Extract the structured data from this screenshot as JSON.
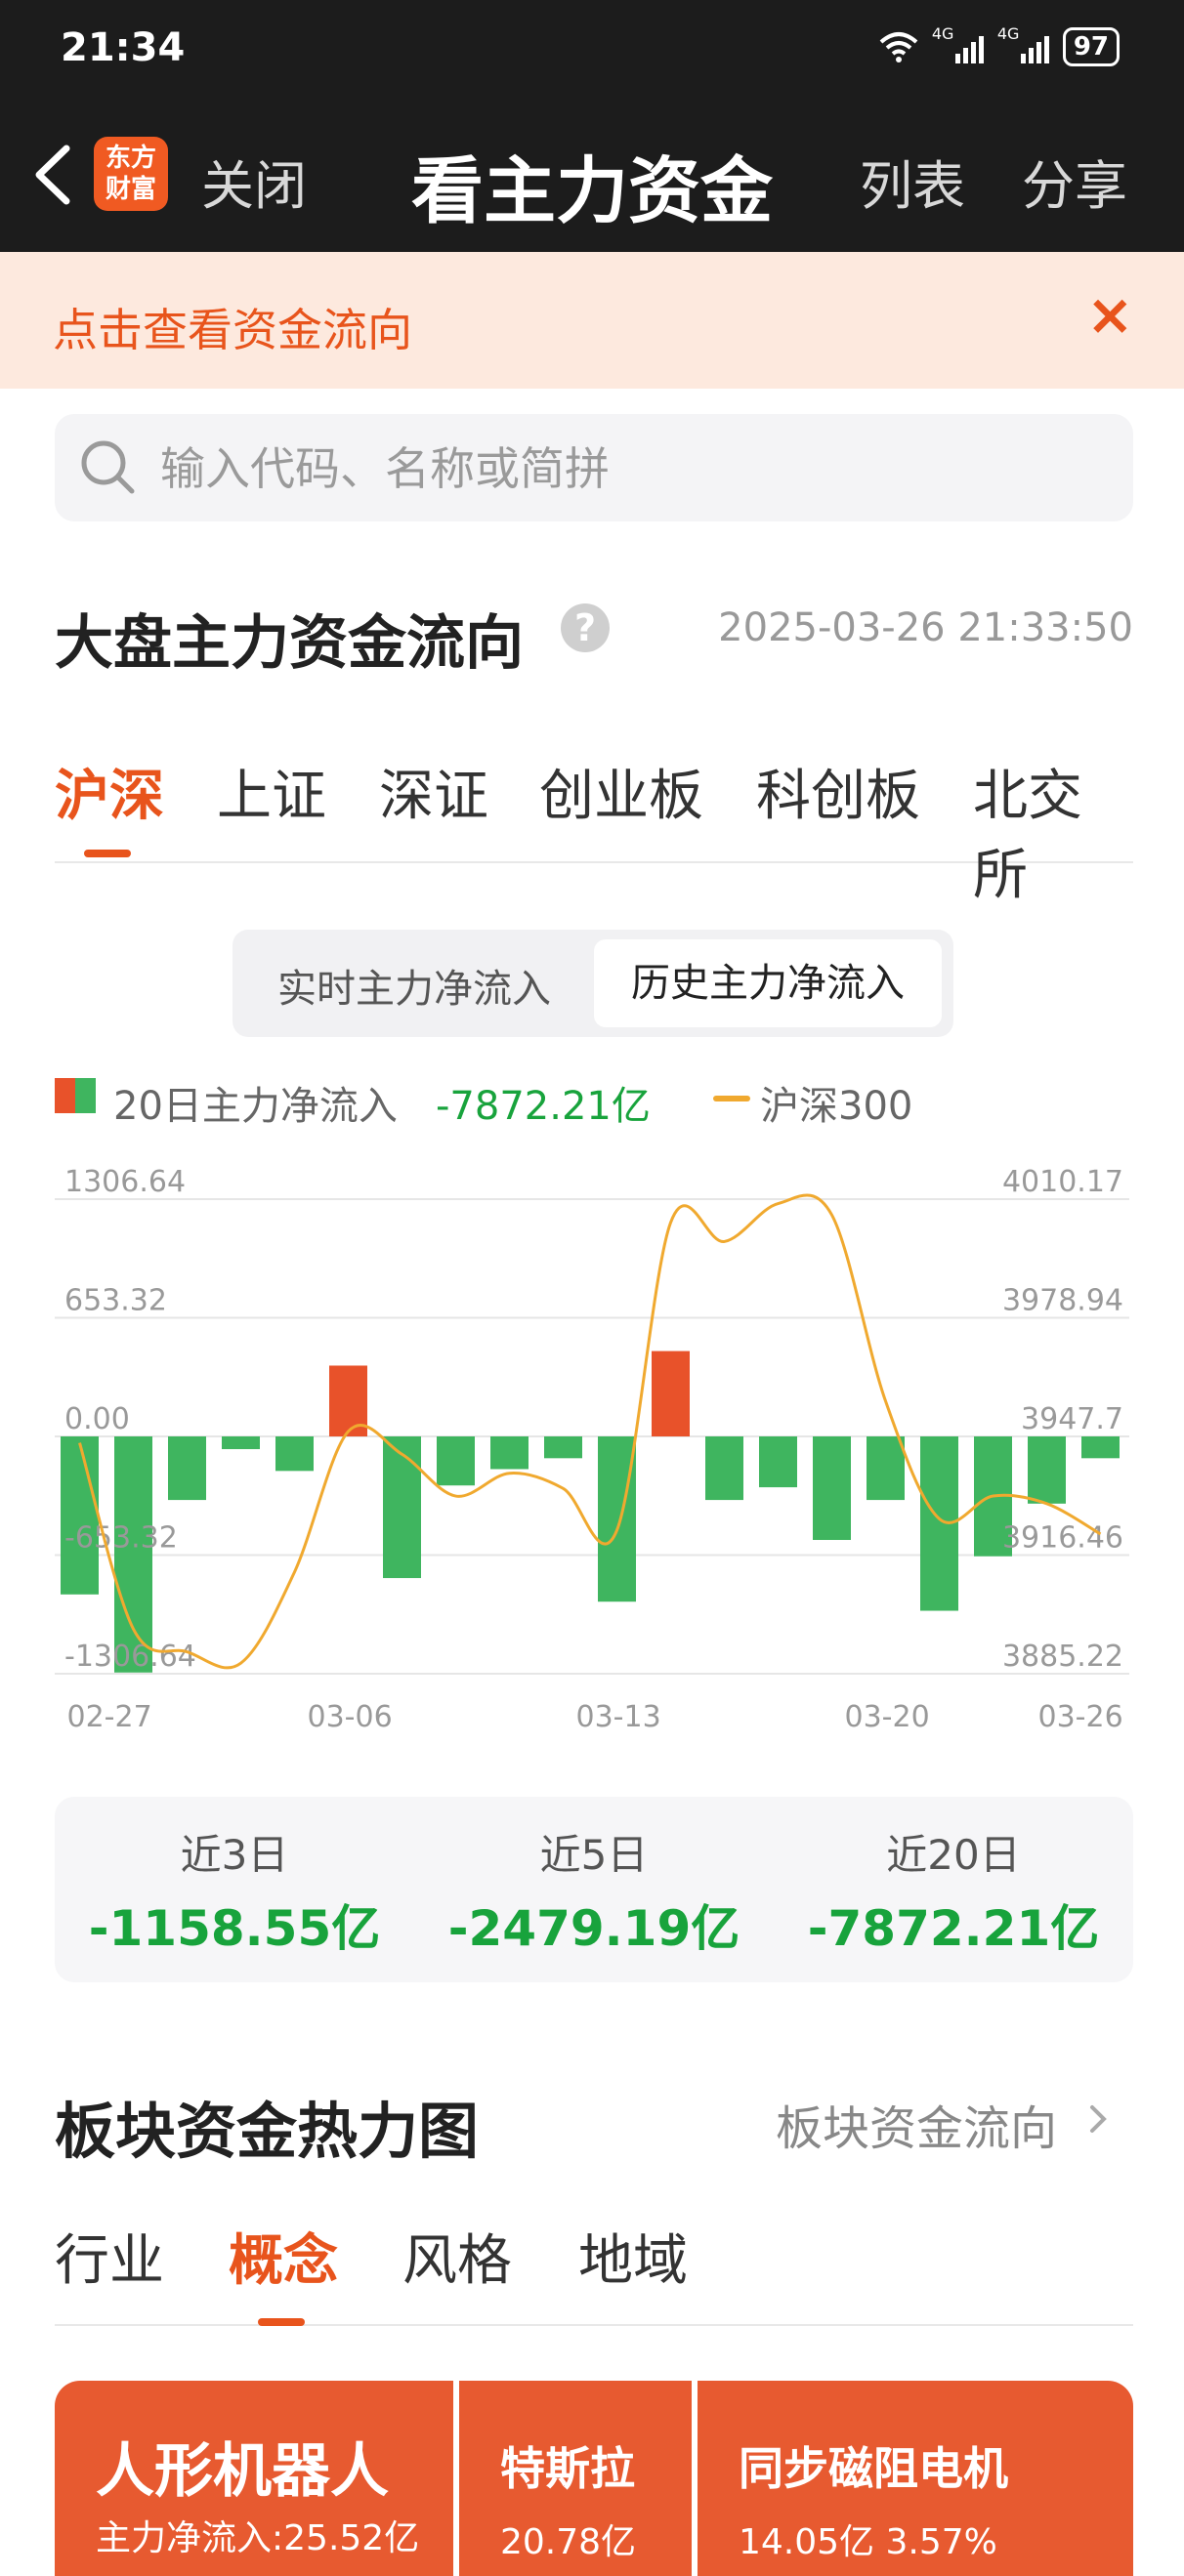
{
  "status": {
    "time": "21:34",
    "battery": "97",
    "net1": "4G",
    "net2": "4G"
  },
  "nav": {
    "close": "关闭",
    "title": "看主力资金",
    "list": "列表",
    "share": "分享",
    "logo_top": "东方",
    "logo_bottom": "财富"
  },
  "banner": {
    "text": "点击查看资金流向",
    "close_icon": "×"
  },
  "search": {
    "placeholder": "输入代码、名称或简拼"
  },
  "section1": {
    "title": "大盘主力资金流向",
    "help": "?",
    "timestamp": "2025-03-26 21:33:50"
  },
  "market_tabs": [
    "沪深",
    "上证",
    "深证",
    "创业板",
    "科创板",
    "北交所"
  ],
  "toggle": {
    "realtime": "实时主力净流入",
    "history": "历史主力净流入"
  },
  "legend": {
    "net_label": "20日主力净流入",
    "net_value": "-7872.21亿",
    "index_label": "沪深300"
  },
  "colors": {
    "accent": "#e8541c",
    "inflow": "#e8522a",
    "outflow": "#3fb55f",
    "index_line": "#f0a92f",
    "green_text": "#18a33c"
  },
  "chart_data": {
    "type": "bar",
    "left_ticks": [
      "1306.64",
      "653.32",
      "0.00",
      "-653.32",
      "-1306.64"
    ],
    "right_ticks": [
      "4010.17",
      "3978.94",
      "3947.7",
      "3916.46",
      "3885.22"
    ],
    "ylim": [
      -1306.64,
      1306.64
    ],
    "y2lim": [
      3885.22,
      4010.17
    ],
    "x_ticks": [
      "02-27",
      "03-06",
      "03-13",
      "03-20",
      "03-26"
    ],
    "categories": [
      "02-27",
      "02-28",
      "03-03",
      "03-04",
      "03-05",
      "03-06",
      "03-07",
      "03-10",
      "03-11",
      "03-12",
      "03-13",
      "03-14",
      "03-17",
      "03-18",
      "03-19",
      "03-20",
      "03-21",
      "03-24",
      "03-25",
      "03-26"
    ],
    "series": [
      {
        "values": [
          -870,
          -1300,
          -350,
          -70,
          -190,
          390,
          -780,
          -270,
          -180,
          -120,
          -910,
          470,
          -350,
          -280,
          -570,
          -350,
          -960,
          -660,
          -370,
          -120
        ]
      },
      {
        "name": "沪深300",
        "values": [
          3946,
          3897,
          3891,
          3888,
          3912,
          3949,
          3943,
          3932,
          3938,
          3934,
          3923,
          4004,
          3999,
          4009,
          4006,
          3957,
          3926,
          3932,
          3930,
          3922
        ]
      }
    ]
  },
  "summary": [
    {
      "label": "近3日",
      "value": "-1158.55亿"
    },
    {
      "label": "近5日",
      "value": "-2479.19亿"
    },
    {
      "label": "近20日",
      "value": "-7872.21亿"
    }
  ],
  "section2": {
    "title": "板块资金热力图",
    "link": "板块资金流向"
  },
  "board_tabs": [
    "行业",
    "概念",
    "风格",
    "地域"
  ],
  "heatmap": [
    {
      "name": "人形机器人",
      "sub": "主力净流入:25.52亿"
    },
    {
      "name": "特斯拉",
      "sub": "20.78亿"
    },
    {
      "name": "同步磁阻电机",
      "sub": "14.05亿  3.57%"
    }
  ]
}
